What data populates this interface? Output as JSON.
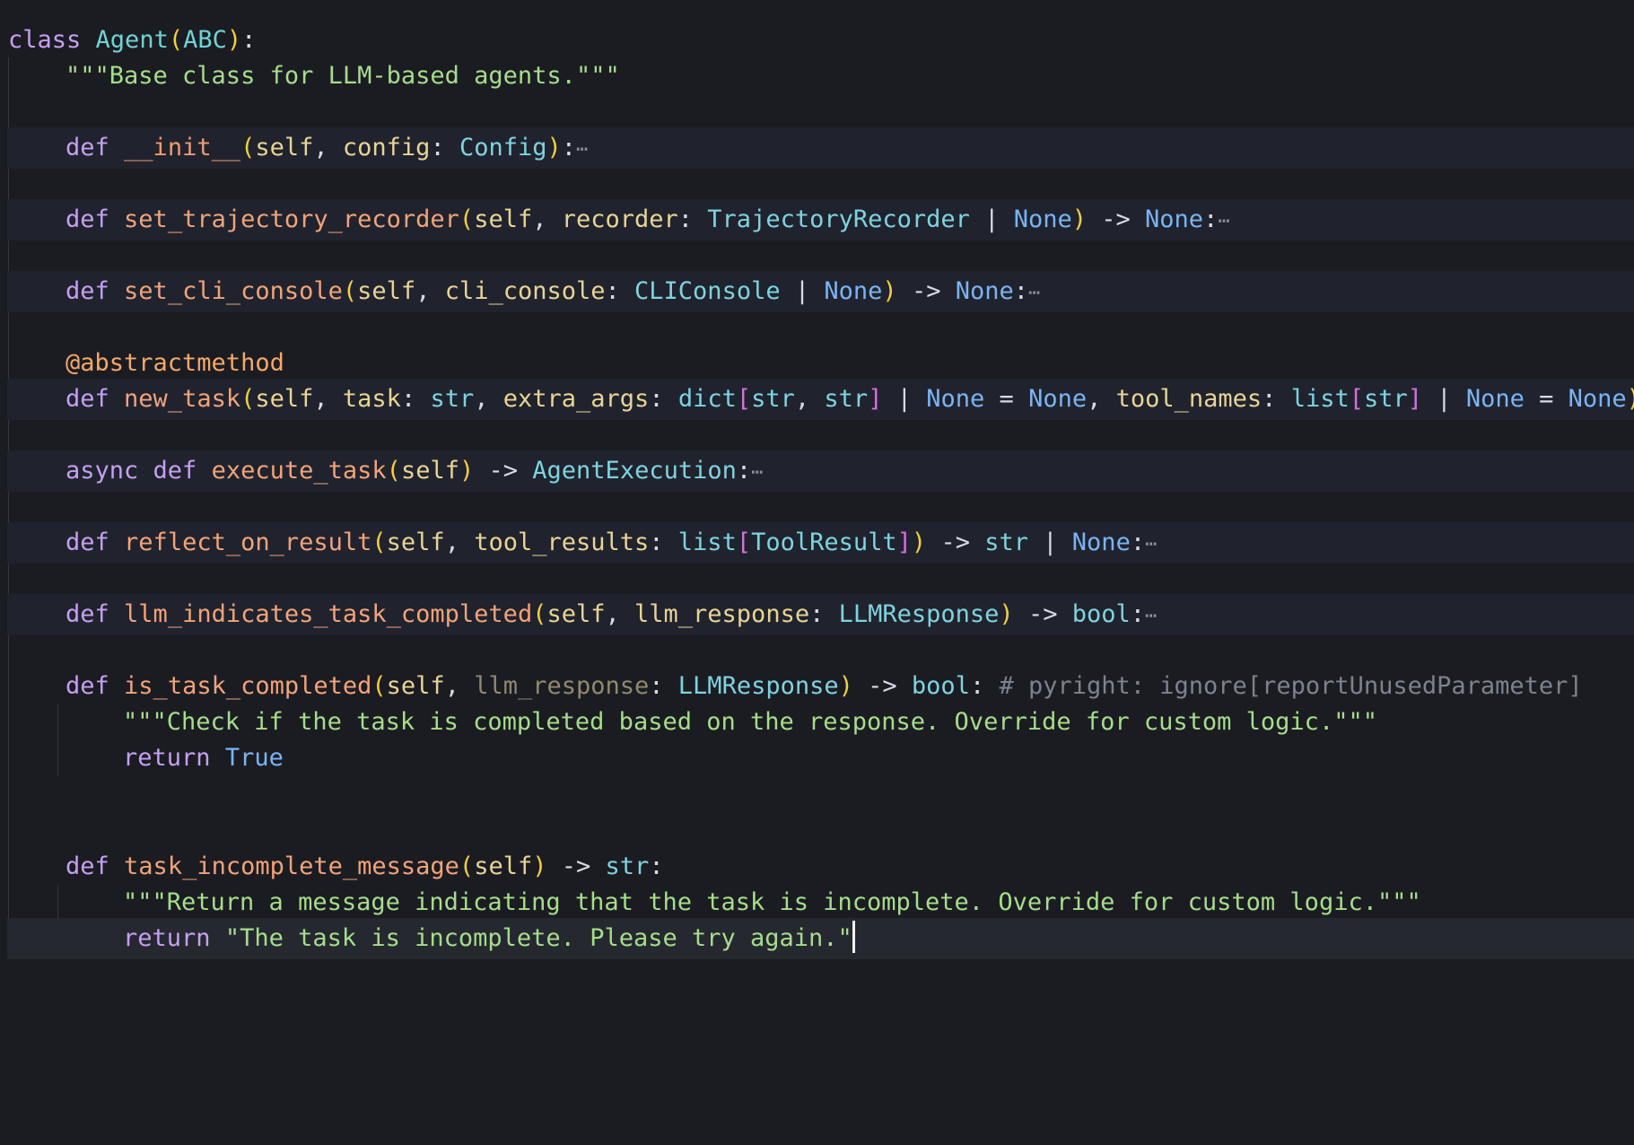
{
  "editor": {
    "language": "python",
    "lines": [
      {
        "id": "class-line",
        "tokens": [
          "class",
          "Agent",
          "(",
          "ABC",
          ")",
          ":"
        ]
      },
      {
        "id": "class-docstring",
        "text": "\"\"\"Base class for LLM-based agents.\"\"\""
      },
      {
        "id": "init",
        "def": "def",
        "name": "__init__",
        "params": [
          "self",
          "config",
          "Config"
        ],
        "folded": true
      },
      {
        "id": "set-trajectory-recorder",
        "name": "set_trajectory_recorder",
        "param": "recorder",
        "type": "TrajectoryRecorder",
        "folded": true
      },
      {
        "id": "set-cli-console",
        "name": "set_cli_console",
        "param": "cli_console",
        "type": "CLIConsole",
        "folded": true
      },
      {
        "id": "decorator",
        "text": "@abstractmethod"
      },
      {
        "id": "new-task",
        "name": "new_task"
      },
      {
        "id": "execute-task",
        "async": "async",
        "name": "execute_task",
        "ret": "AgentExecution",
        "folded": true
      },
      {
        "id": "reflect-on-result",
        "name": "reflect_on_result",
        "param": "tool_results",
        "type": "ToolResult",
        "folded": true
      },
      {
        "id": "llm-indicates-task-completed",
        "name": "llm_indicates_task_completed",
        "param": "llm_response",
        "type": "LLMResponse",
        "folded": true
      },
      {
        "id": "is-task-completed",
        "name": "is_task_completed",
        "param": "llm_response",
        "type": "LLMResponse",
        "comment": "# pyright: ignore[reportUnusedParameter]"
      },
      {
        "id": "is-task-completed-doc",
        "text": "\"\"\"Check if the task is completed based on the response. Override for custom logic.\"\"\""
      },
      {
        "id": "is-task-completed-return",
        "kw": "return",
        "value": "True"
      },
      {
        "id": "task-incomplete-message",
        "name": "task_incomplete_message"
      },
      {
        "id": "task-incomplete-doc",
        "text": "\"\"\"Return a message indicating that the task is incomplete. Override for custom logic.\"\"\""
      },
      {
        "id": "task-incomplete-return",
        "kw": "return",
        "value": "\"The task is incomplete. Please try again.\""
      }
    ],
    "words": {
      "class": "class",
      "def": "def",
      "async": "async",
      "return": "return",
      "self": "self",
      "none": "None",
      "str": "str",
      "bool": "bool",
      "dict": "dict",
      "list": "list",
      "true": "True",
      "arrow": "->",
      "ellipsis": "⋯",
      "agent": "Agent",
      "abc": "ABC",
      "config_param": "config",
      "config_type": "Config",
      "init": "__init__",
      "set_traj": "set_trajectory_recorder",
      "recorder": "recorder",
      "traj_type": "TrajectoryRecorder",
      "set_cli": "set_cli_console",
      "cli_console": "cli_console",
      "cli_type": "CLIConsole",
      "decorator": "@abstractmethod",
      "new_task": "new_task",
      "task": "task",
      "extra_args": "extra_args",
      "tool_names": "tool_names",
      "execute_task": "execute_task",
      "agent_execution": "AgentExecution",
      "reflect": "reflect_on_result",
      "tool_results": "tool_results",
      "tool_result": "ToolResult",
      "llm_indicates": "llm_indicates_task_completed",
      "llm_response": "llm_response",
      "llm_response_type": "LLMResponse",
      "is_task_completed": "is_task_completed",
      "pyright_comment": "# pyright: ignore[reportUnusedParameter]",
      "doc_class": "\"\"\"Base class for LLM-based agents.\"\"\"",
      "doc_check": "\"\"\"Check if the task is completed based on the response. Override for custom logic.\"\"\"",
      "task_incomplete": "task_incomplete_message",
      "doc_incomplete": "\"\"\"Return a message indicating that the task is incomplete. Override for custom logic.\"\"\"",
      "incomplete_str": "\"The task is incomplete. Please try again.\""
    }
  },
  "colors": {
    "background": "#1b1c22",
    "folded_line_bg": "#20232d",
    "active_line_bg": "#262830",
    "keyword": "#c4a0f0",
    "function": "#f2a37a",
    "parameter": "#e8d497",
    "type": "#7fd3df",
    "none": "#7ab4f5",
    "string": "#a6dd8b",
    "comment": "#7e828c",
    "bracket_level1": "#f3cf3f",
    "bracket_level2": "#d56fe0"
  }
}
